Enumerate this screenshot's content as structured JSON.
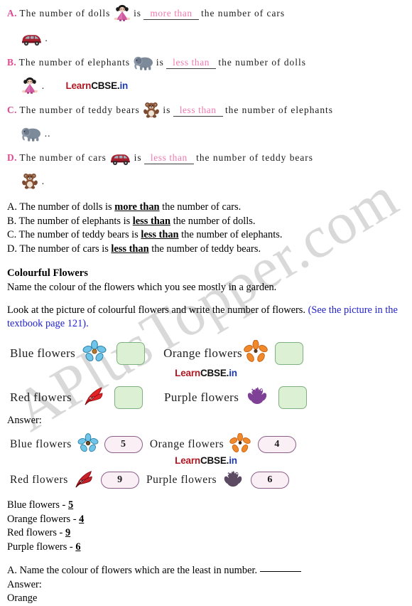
{
  "watermark": {
    "text": "APlusTopper.com"
  },
  "brand": {
    "part1": "Learn",
    "part2": "CBSE.",
    "part3": "in"
  },
  "worksheet": {
    "items": [
      {
        "letter": "A.",
        "before": "The number of dolls",
        "icon1": "doll-icon",
        "is": "is",
        "blank": "more than",
        "after": "the number of cars",
        "icon2": "car-icon",
        "period": "."
      },
      {
        "letter": "B.",
        "before": "The number of elephants",
        "icon1": "elephant-icon",
        "is": "is",
        "blank": "less than",
        "after": "the number of dolls",
        "icon2": "doll-icon",
        "period": "."
      },
      {
        "letter": "C.",
        "before": "The number of teddy bears",
        "icon1": "teddy-bear-icon",
        "is": "is",
        "blank": "less than",
        "after": "the number of elephants",
        "icon2": "elephant-icon",
        "period": ".."
      },
      {
        "letter": "D.",
        "before": "The number of cars",
        "icon1": "car-icon",
        "is": "is",
        "blank": "less than",
        "after": "the number of teddy bears",
        "icon2": "teddy-bear-icon",
        "period": "."
      }
    ]
  },
  "typed_answers": [
    {
      "prefix": "A. The number of dolls is ",
      "emph": "more than",
      "suffix": " the number of cars."
    },
    {
      "prefix": "B. The number of elephants is ",
      "emph": "less than",
      "suffix": " the number of dolls."
    },
    {
      "prefix": "C. The number of teddy bears is ",
      "emph": "less than",
      "suffix": " the number of elephants."
    },
    {
      "prefix": "D. The number of cars is ",
      "emph": "less than",
      "suffix": " the number of teddy bears."
    }
  ],
  "flowers_section": {
    "heading": "Colourful Flowers",
    "intro": "Name the colour of the flowers which you see mostly in a garden.",
    "instruction_black": "Look at the picture of colourful flowers and write the number of flowers.",
    "instruction_blue": "(See the picture in the textbook page 121).",
    "blank_rows": [
      {
        "label": "Blue flowers",
        "icon": "blue-flower-icon"
      },
      {
        "label": "Orange flowers",
        "icon": "orange-flower-icon"
      },
      {
        "label": "Red flowers",
        "icon": "red-flower-icon"
      },
      {
        "label": "Purple flowers",
        "icon": "purple-flower-icon"
      }
    ],
    "answer_label": "Answer:",
    "filled_rows": [
      {
        "label": "Blue flowers",
        "icon": "blue-flower-icon",
        "value": "5"
      },
      {
        "label": "Orange flowers",
        "icon": "orange-flower-icon",
        "value": "4"
      },
      {
        "label": "Red flowers",
        "icon": "red-flower-icon",
        "value": "9"
      },
      {
        "label": "Purple flowers",
        "icon": "purple-flower-icon",
        "value": "6"
      }
    ],
    "typed_counts": [
      {
        "label": "Blue flowers - ",
        "value": "5"
      },
      {
        "label": "Orange flowers - ",
        "value": "4"
      },
      {
        "label": "Red flowers - ",
        "value": "9"
      },
      {
        "label": "Purple flowers - ",
        "value": "6"
      }
    ],
    "question_a": "A. Name the colour of flowers which are the least in number.",
    "answer_a_label": "Answer:",
    "answer_a_value": "Orange"
  }
}
